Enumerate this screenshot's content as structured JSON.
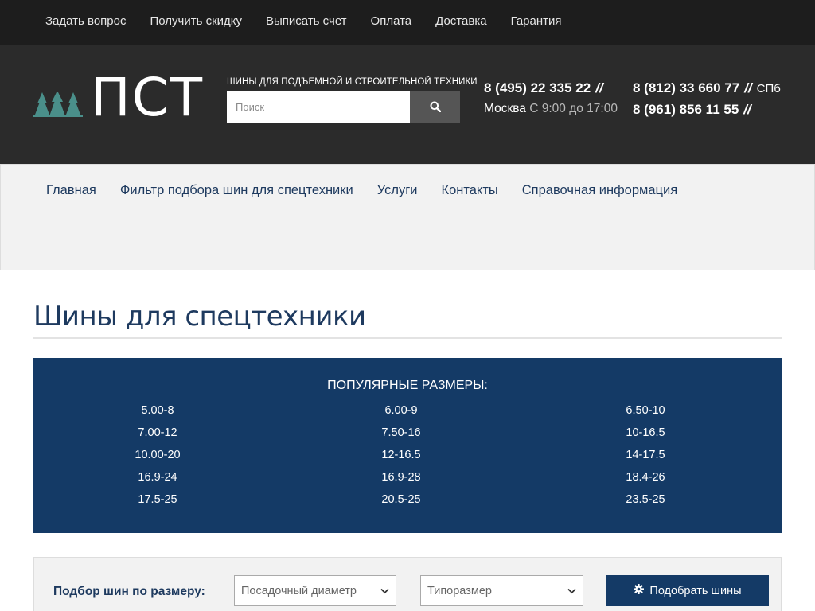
{
  "topnav": {
    "items": [
      "Задать вопрос",
      "Получить скидку",
      "Выписать счет",
      "Оплата",
      "Доставка",
      "Гарантия"
    ]
  },
  "header": {
    "logo_text": "ПСТ",
    "tagline": "шины для подъемной и строительной техники",
    "search": {
      "placeholder": "Поиск",
      "button_icon": "search-icon"
    },
    "phones": {
      "moscow": {
        "number": "8 (495) 22 335 22",
        "sep": "//",
        "city": "Москва",
        "hours": "С 9:00 до 17:00"
      },
      "spb": {
        "number": "8 (812) 33 660 77",
        "sep": "//",
        "city": "СПб"
      },
      "mobile": {
        "number": "8 (961) 856 11 55",
        "sep": "//"
      }
    }
  },
  "mainnav": {
    "items": [
      "Главная",
      "Фильтр подбора шин для спецтехники",
      "Услуги",
      "Контакты",
      "Справочная информация"
    ]
  },
  "page": {
    "title": "Шины для спецтехники"
  },
  "popular": {
    "title": "ПОПУЛЯРНЫЕ РАЗМЕРЫ:",
    "sizes": [
      "5.00-8",
      "6.00-9",
      "6.50-10",
      "7.00-12",
      "7.50-16",
      "10-16.5",
      "10.00-20",
      "12-16.5",
      "14-17.5",
      "16.9-24",
      "16.9-28",
      "18.4-26",
      "17.5-25",
      "20.5-25",
      "23.5-25"
    ]
  },
  "filter": {
    "label": "Подбор шин по размеру:",
    "select_diameter": "Посадочный диаметр",
    "select_size": "Типоразмер",
    "button": "Подобрать шины"
  },
  "colors": {
    "topbar": "#1d1d1d",
    "header": "#2b2b2b",
    "accent": "#143a66",
    "nav_text": "#1e3a5f",
    "logo_trees": "#4a8f8a"
  }
}
